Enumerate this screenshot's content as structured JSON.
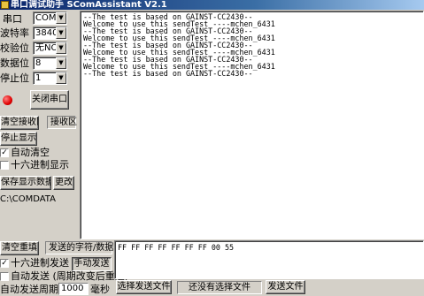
{
  "window": {
    "title": "串口调试助手 SComAssistant V2.1"
  },
  "settings": {
    "port_label": "串口",
    "port_value": "COM1",
    "baud_label": "波特率",
    "baud_value": "38400",
    "parity_label": "校验位",
    "parity_value": "无NONE",
    "databits_label": "数据位",
    "databits_value": "8",
    "stopbits_label": "停止位",
    "stopbits_value": "1"
  },
  "port_control": {
    "status_led_color": "#e00000",
    "close_port_label": "关闭串口"
  },
  "receive": {
    "clear_label": "清空接收区",
    "receive_area_label": "接收区",
    "stop_display_label": "停止显示",
    "auto_clear_label": "自动清空",
    "auto_clear_checked": true,
    "hex_display_label": "十六进制显示",
    "hex_display_checked": false,
    "save_data_label": "保存显示数据",
    "change_label": "更改",
    "save_path": "C:\\COMDATA",
    "text": "--The test is based on GAINST-CC2430--\nWelcome to use this sendTest ----mchen_6431\n--The test is based on GAINST-CC2430--\nWelcome to use this sendTest ----mchen_6431\n--The test is based on GAINST-CC2430--\nWelcome to use this sendTest ----mchen_6431\n--The test is based on GAINST-CC2430--\nWelcome to use this sendTest ----mchen_6431\n--The test is based on GAINST-CC2430--"
  },
  "send": {
    "clear_resend_label": "清空重填",
    "send_chars_label": "发送的字符/数据",
    "hex_send_label": "十六进制发送",
    "hex_send_checked": true,
    "manual_send_label": "手动发送",
    "auto_send_label": "自动发送 (周期改变后重选)",
    "auto_send_checked": false,
    "auto_period_label": "自动发送周期：",
    "auto_period_value": "1000",
    "ms_label": "毫秒",
    "select_file_label": "选择发送文件",
    "file_status": "还没有选择文件",
    "send_file_label": "发送文件",
    "text": "FF FF FF FF FF FF FF 00 55"
  }
}
